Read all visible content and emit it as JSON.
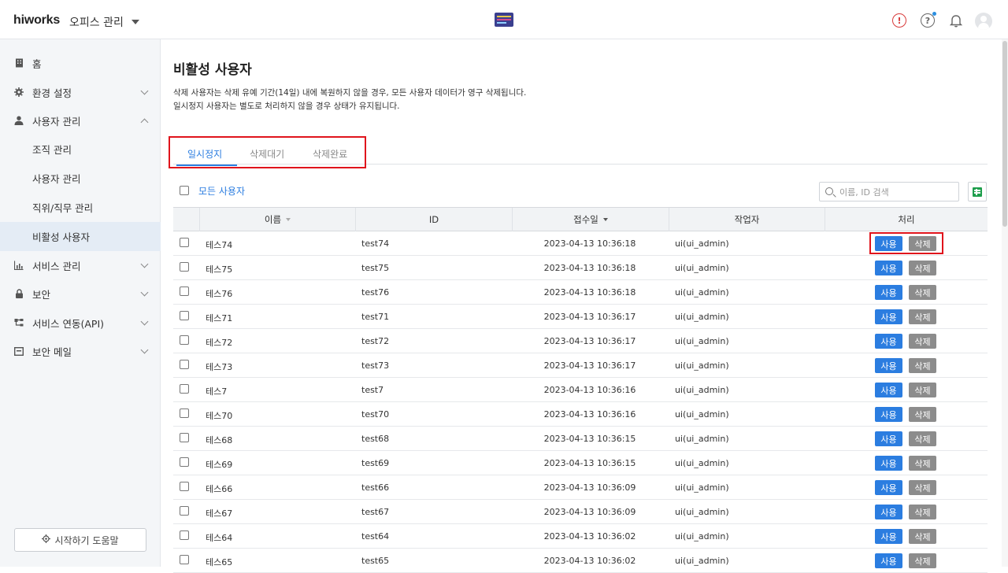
{
  "header": {
    "brand": "hiworks",
    "office_menu": "오피스 관리",
    "alert_glyph": "!",
    "help_glyph": "?"
  },
  "sidebar": {
    "items": [
      {
        "label": "홈",
        "icon": "building-icon"
      },
      {
        "label": "환경 설정",
        "icon": "gear-icon"
      },
      {
        "label": "사용자 관리",
        "icon": "person-icon"
      },
      {
        "label": "서비스 관리",
        "icon": "chart-icon"
      },
      {
        "label": "보안",
        "icon": "lock-icon"
      },
      {
        "label": "서비스 연동(API)",
        "icon": "hierarchy-icon"
      },
      {
        "label": "보안 메일",
        "icon": "mail-icon"
      }
    ],
    "sub_items": [
      {
        "label": "조직 관리"
      },
      {
        "label": "사용자 관리"
      },
      {
        "label": "직위/직무 관리"
      },
      {
        "label": "비활성 사용자"
      }
    ],
    "help_button": "시작하기 도움말"
  },
  "main": {
    "title": "비활성 사용자",
    "desc_line1": "삭제 사용자는 삭제 유예 기간(14일) 내에 복원하지 않을 경우, 모든 사용자 데이터가 영구 삭제됩니다.",
    "desc_line2": "일시정지 사용자는 별도로 처리하지 않을 경우 상태가 유지됩니다.",
    "tabs": [
      {
        "label": "일시정지"
      },
      {
        "label": "삭제대기"
      },
      {
        "label": "삭제완료"
      }
    ],
    "all_users_label": "모든 사용자",
    "search_placeholder": "이름, ID 검색"
  },
  "table": {
    "headers": {
      "name": "이름",
      "id": "ID",
      "date": "접수일",
      "operator": "작업자",
      "action": "처리"
    },
    "use_label": "사용",
    "delete_label": "삭제",
    "rows": [
      {
        "name": "테스74",
        "id": "test74",
        "date": "2023-04-13 10:36:18",
        "operator": "ui(ui_admin)"
      },
      {
        "name": "테스75",
        "id": "test75",
        "date": "2023-04-13 10:36:18",
        "operator": "ui(ui_admin)"
      },
      {
        "name": "테스76",
        "id": "test76",
        "date": "2023-04-13 10:36:18",
        "operator": "ui(ui_admin)"
      },
      {
        "name": "테스71",
        "id": "test71",
        "date": "2023-04-13 10:36:17",
        "operator": "ui(ui_admin)"
      },
      {
        "name": "테스72",
        "id": "test72",
        "date": "2023-04-13 10:36:17",
        "operator": "ui(ui_admin)"
      },
      {
        "name": "테스73",
        "id": "test73",
        "date": "2023-04-13 10:36:17",
        "operator": "ui(ui_admin)"
      },
      {
        "name": "테스7",
        "id": "test7",
        "date": "2023-04-13 10:36:16",
        "operator": "ui(ui_admin)"
      },
      {
        "name": "테스70",
        "id": "test70",
        "date": "2023-04-13 10:36:16",
        "operator": "ui(ui_admin)"
      },
      {
        "name": "테스68",
        "id": "test68",
        "date": "2023-04-13 10:36:15",
        "operator": "ui(ui_admin)"
      },
      {
        "name": "테스69",
        "id": "test69",
        "date": "2023-04-13 10:36:15",
        "operator": "ui(ui_admin)"
      },
      {
        "name": "테스66",
        "id": "test66",
        "date": "2023-04-13 10:36:09",
        "operator": "ui(ui_admin)"
      },
      {
        "name": "테스67",
        "id": "test67",
        "date": "2023-04-13 10:36:09",
        "operator": "ui(ui_admin)"
      },
      {
        "name": "테스64",
        "id": "test64",
        "date": "2023-04-13 10:36:02",
        "operator": "ui(ui_admin)"
      },
      {
        "name": "테스65",
        "id": "test65",
        "date": "2023-04-13 10:36:02",
        "operator": "ui(ui_admin)"
      }
    ]
  },
  "colors": {
    "accent": "#2b7de0",
    "delete_button": "#8c8c8c",
    "highlight": "#e0141c",
    "sidebar_bg": "#f4f6f8"
  }
}
